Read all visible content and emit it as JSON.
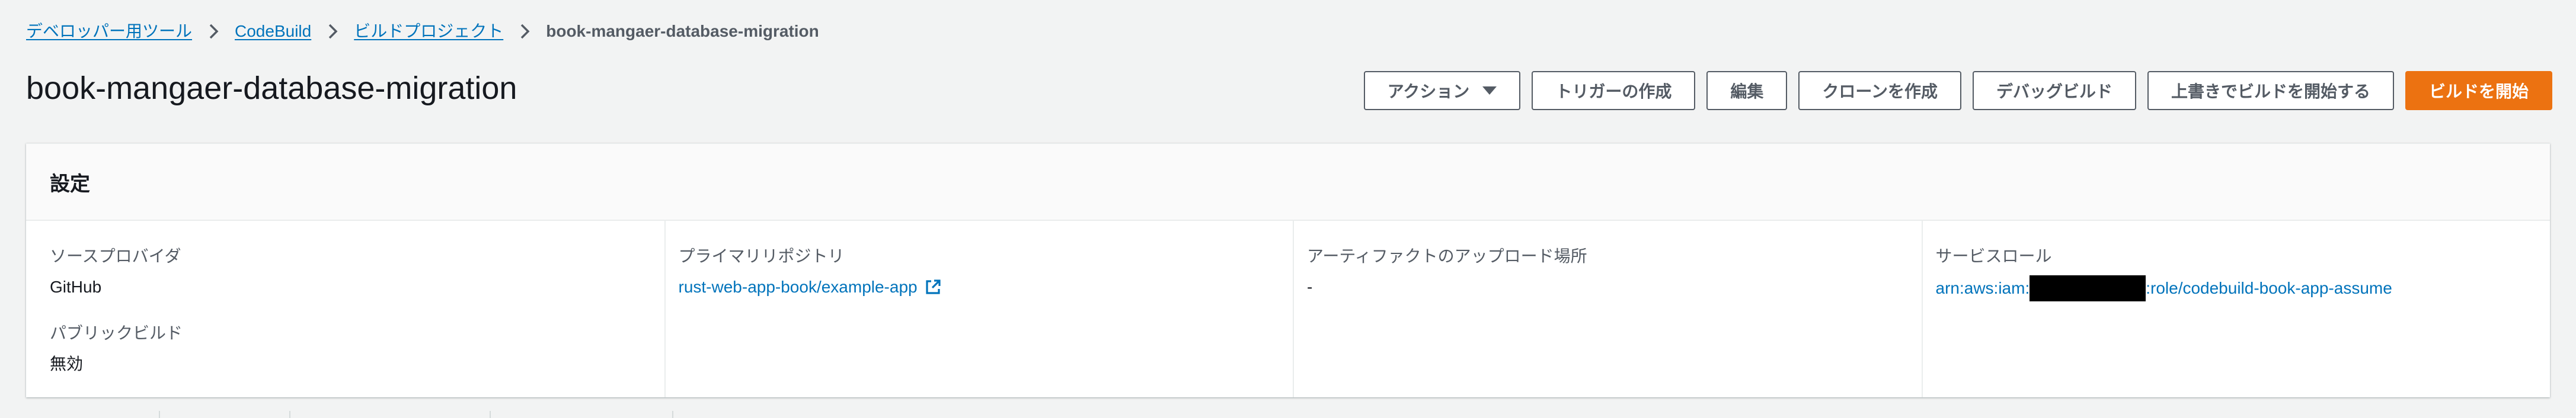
{
  "breadcrumb": {
    "items": [
      {
        "label": "デベロッパー用ツール"
      },
      {
        "label": "CodeBuild"
      },
      {
        "label": "ビルドプロジェクト"
      }
    ],
    "current": "book-mangaer-database-migration",
    "separator_icon": "chevron-right-icon"
  },
  "page": {
    "title": "book-mangaer-database-migration"
  },
  "actions": {
    "action_menu": "アクション",
    "create_trigger": "トリガーの作成",
    "edit": "編集",
    "clone": "クローンを作成",
    "debug_build": "デバッグビルド",
    "start_with_overrides": "上書きでビルドを開始する",
    "start_build": "ビルドを開始"
  },
  "settings": {
    "title": "設定",
    "source_provider": {
      "label": "ソースプロバイダ",
      "value": "GitHub"
    },
    "public_build": {
      "label": "パブリックビルド",
      "value": "無効"
    },
    "primary_repository": {
      "label": "プライマリリポジトリ",
      "value": "rust-web-app-book/example-app",
      "icon": "external-link-icon"
    },
    "artifact_upload_location": {
      "label": "アーティファクトのアップロード場所",
      "value": "-"
    },
    "service_role": {
      "label": "サービスロール",
      "value_prefix": "arn:aws:iam:",
      "value_suffix": ":role/codebuild-book-app-assume"
    }
  },
  "colors": {
    "background": "#f2f3f3",
    "link": "#0073bb",
    "primary_button": "#ec7211",
    "text": "#16191f",
    "secondary_text": "#545b64"
  }
}
